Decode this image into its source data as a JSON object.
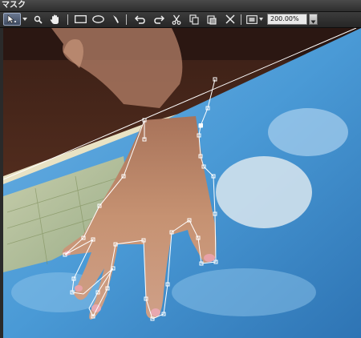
{
  "window": {
    "title": "マスク"
  },
  "toolbar": {
    "tools": [
      {
        "name": "select-pointer",
        "icon": "arrow-pointer-icon",
        "active": true
      },
      {
        "name": "zoom",
        "icon": "magnifier-icon"
      },
      {
        "name": "pan",
        "icon": "hand-icon"
      },
      {
        "name": "rectangle",
        "icon": "rectangle-icon"
      },
      {
        "name": "ellipse",
        "icon": "ellipse-icon"
      },
      {
        "name": "pen",
        "icon": "pen-icon"
      },
      {
        "name": "undo",
        "icon": "undo-icon"
      },
      {
        "name": "redo",
        "icon": "redo-icon"
      },
      {
        "name": "cut",
        "icon": "scissors-icon"
      },
      {
        "name": "copy",
        "icon": "copy-icon"
      },
      {
        "name": "paste",
        "icon": "paste-icon"
      },
      {
        "name": "delete",
        "icon": "x-delete-icon"
      },
      {
        "name": "fit-view",
        "icon": "fit-view-icon"
      }
    ],
    "zoom_value": "200.00%"
  },
  "colors": {
    "accent": "#6a7890",
    "mask_path": "#ffffff",
    "book_blue": "#4a9ad6",
    "skin": "#c69272"
  }
}
